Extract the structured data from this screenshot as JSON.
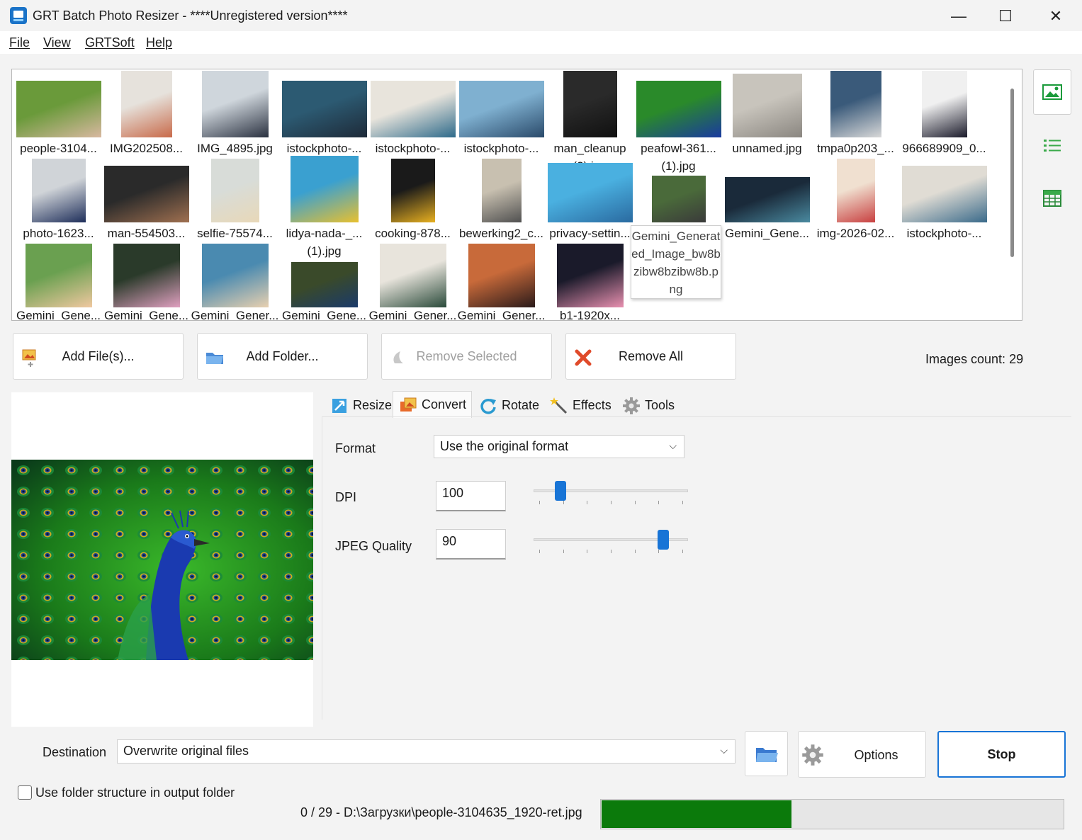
{
  "window": {
    "title": "GRT Batch Photo Resizer - ****Unregistered version****",
    "minimize": "—",
    "maximize": "☐",
    "close": "✕"
  },
  "menu": [
    "File",
    "View",
    "GRTSoft",
    "Help"
  ],
  "thumbnails": [
    {
      "label": "people-3104...",
      "colors": [
        "#6a9a3a",
        "#d8b8a0"
      ]
    },
    {
      "label": "IMG202508...",
      "colors": [
        "#e6e2dc",
        "#c86a4a"
      ]
    },
    {
      "label": "IMG_4895.jpg",
      "colors": [
        "#cfd6dc",
        "#2a3140"
      ]
    },
    {
      "label": "istockphoto-...",
      "colors": [
        "#2c5a72",
        "#1e2a38"
      ]
    },
    {
      "label": "istockphoto-...",
      "colors": [
        "#e8e4dc",
        "#2e6a8a"
      ]
    },
    {
      "label": "istockphoto-...",
      "colors": [
        "#7fb0d0",
        "#2a4a6a"
      ]
    },
    {
      "label": "man_cleanup (2).jpg",
      "colors": [
        "#2a2a2a",
        "#101010"
      ]
    },
    {
      "label": "peafowl-361... (1).jpg",
      "colors": [
        "#2a8a2a",
        "#1a3aa0"
      ]
    },
    {
      "label": "unnamed.jpg",
      "colors": [
        "#c8c4bc",
        "#8a8680"
      ]
    },
    {
      "label": "tmpa0p203_...",
      "colors": [
        "#3a5a7a",
        "#d8d8d8"
      ]
    },
    {
      "label": "966689909_0...",
      "colors": [
        "#f0f0f0",
        "#1a1a2a"
      ]
    },
    {
      "label": "photo-1623...",
      "colors": [
        "#d0d4d8",
        "#1e2e5a"
      ]
    },
    {
      "label": "man-554503...",
      "colors": [
        "#2a2a2a",
        "#a07050"
      ]
    },
    {
      "label": "selfie-75574...",
      "colors": [
        "#d8dcd8",
        "#e8d8b8"
      ]
    },
    {
      "label": "lidya-nada-_... (1).jpg",
      "colors": [
        "#3aa0d0",
        "#e8c030"
      ]
    },
    {
      "label": "cooking-878...",
      "colors": [
        "#1a1a1a",
        "#e8b020"
      ]
    },
    {
      "label": "bewerking2_c...",
      "colors": [
        "#c8c0b0",
        "#505050"
      ]
    },
    {
      "label": "privacy-settin...",
      "colors": [
        "#4ab0e0",
        "#2a6aa0"
      ]
    },
    {
      "label": "Gemini_Generated_Image_bw8bzibw8bzibw8b.png",
      "colors": [
        "#4a6a3a",
        "#3a3a3a"
      ]
    },
    {
      "label": "Gemini_Gene...",
      "colors": [
        "#1a2a3a",
        "#4a8aa0"
      ]
    },
    {
      "label": "img-2026-02...",
      "colors": [
        "#f0e0d0",
        "#c84040"
      ]
    },
    {
      "label": "istockphoto-...",
      "colors": [
        "#e0dcd4",
        "#3a6a8a"
      ]
    },
    {
      "label": "Gemini_Gene...",
      "colors": [
        "#6aa050",
        "#f0c8a0"
      ]
    },
    {
      "label": "Gemini_Gene...",
      "colors": [
        "#2a3a2a",
        "#e0a0c0"
      ]
    },
    {
      "label": "Gemini_Gener...",
      "colors": [
        "#4a8ab0",
        "#e8d0b0"
      ]
    },
    {
      "label": "Gemini_Gene...",
      "colors": [
        "#3a4a2a",
        "#1a3a6a"
      ]
    },
    {
      "label": "Gemini_Gener...",
      "colors": [
        "#e8e4dc",
        "#2a4a3a"
      ]
    },
    {
      "label": "Gemini_Gener...",
      "colors": [
        "#c86a3a",
        "#2a1a1a"
      ]
    },
    {
      "label": "b1-1920x...",
      "colors": [
        "#1a1a2a",
        "#e890b0"
      ]
    }
  ],
  "tooltip": "Gemini_Generated_Image_bw8bzibw8bzibw8b.png",
  "actions": {
    "add_files": "Add File(s)...",
    "add_folder": "Add Folder...",
    "remove_selected": "Remove Selected",
    "remove_all": "Remove All"
  },
  "images_count": "Images count: 29",
  "tabs": [
    "Resize",
    "Convert",
    "Rotate",
    "Effects",
    "Tools"
  ],
  "active_tab": "Convert",
  "convert": {
    "format_label": "Format",
    "format_value": "Use the original format",
    "dpi_label": "DPI",
    "dpi_value": "100",
    "dpi_slider": 0.12,
    "jpeg_label": "JPEG Quality",
    "jpeg_value": "90",
    "jpeg_slider": 0.9
  },
  "destination": {
    "label": "Destination",
    "value": "Overwrite original files"
  },
  "options_label": "Options",
  "stop_label": "Stop",
  "use_folder_structure": "Use folder structure in output folder",
  "progress": {
    "text": "0 / 29 - D:\\Загрузки\\people-3104635_1920-ret.jpg",
    "fraction": 0.41
  },
  "colors": {
    "accent": "#1874d6",
    "progress": "#0b7a0b"
  }
}
